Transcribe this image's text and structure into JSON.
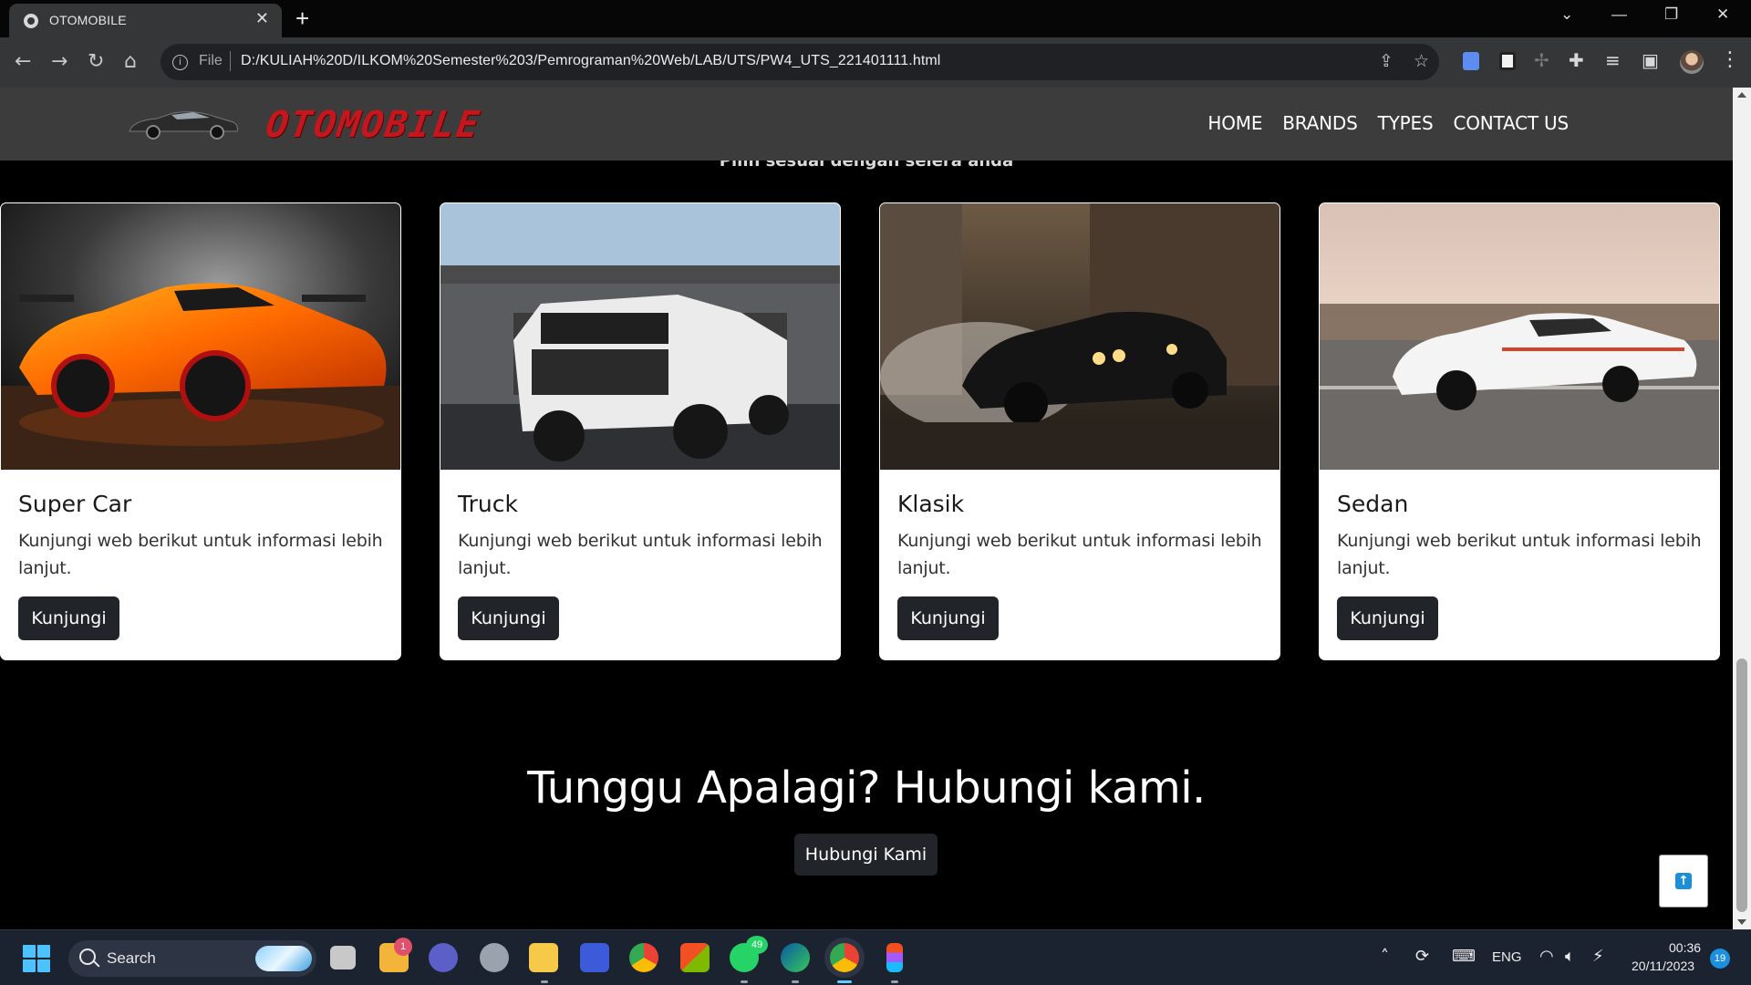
{
  "browser": {
    "tab_title": "OTOMOBILE",
    "tab_close": "✕",
    "new_tab": "+",
    "url_scheme": "File",
    "url": "D:/KULIAH%20D/ILKOM%20Semester%203/Pemrograman%20Web/LAB/UTS/PW4_UTS_221401111.html"
  },
  "site": {
    "logo_text": "OTOMOBILE",
    "nav": [
      "HOME",
      "BRANDS",
      "TYPES",
      "CONTACT US"
    ],
    "partial_subtitle": "Pilih sesuai dengan selera anda"
  },
  "cards": [
    {
      "title": "Super Car",
      "text": "Kunjungi web berikut untuk informasi lebih lanjut.",
      "button": "Kunjungi"
    },
    {
      "title": "Truck",
      "text": "Kunjungi web berikut untuk informasi lebih lanjut.",
      "button": "Kunjungi"
    },
    {
      "title": "Klasik",
      "text": "Kunjungi web berikut untuk informasi lebih lanjut.",
      "button": "Kunjungi"
    },
    {
      "title": "Sedan",
      "text": "Kunjungi web berikut untuk informasi lebih lanjut.",
      "button": "Kunjungi"
    }
  ],
  "cta": {
    "title": "Tunggu Apalagi? Hubungi kami.",
    "button": "Hubungi Kami"
  },
  "taskbar": {
    "search_label": "Search",
    "badge_files": "1",
    "badge_whatsapp": "49",
    "lang": "ENG",
    "time": "00:36",
    "date": "20/11/2023",
    "notifications": "19"
  },
  "colors": {
    "accent": "#c4161c",
    "button_dark": "#212529",
    "navbar": "#3c3c3c"
  }
}
